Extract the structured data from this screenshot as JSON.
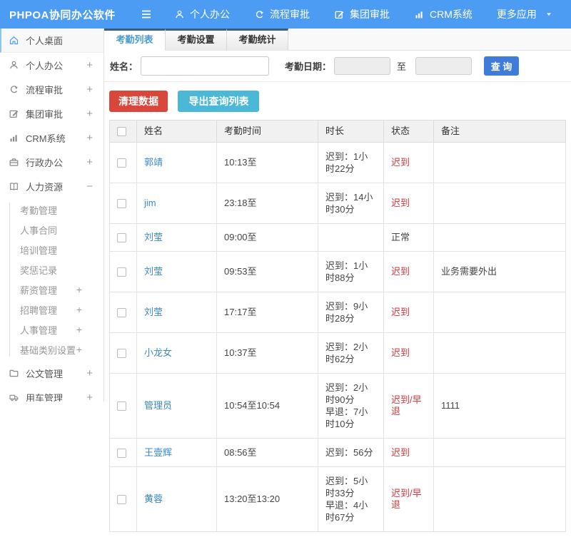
{
  "app": {
    "title": "PHPOA协同办公软件"
  },
  "header": {
    "nav": [
      {
        "key": "personal-office",
        "label": "个人办公",
        "icon": "user-icon"
      },
      {
        "key": "workflow-approval",
        "label": "流程审批",
        "icon": "flow-icon"
      },
      {
        "key": "group-approval",
        "label": "集团审批",
        "icon": "edit-icon"
      },
      {
        "key": "crm-system",
        "label": "CRM系统",
        "icon": "bar-chart-icon"
      },
      {
        "key": "more-apps",
        "label": "更多应用",
        "icon": "caret-down-icon",
        "has_caret": true
      }
    ]
  },
  "sidebar": {
    "items": [
      {
        "key": "personal-desktop",
        "label": "个人桌面",
        "icon": "home-icon",
        "active": true,
        "expand": ""
      },
      {
        "key": "personal-office",
        "label": "个人办公",
        "icon": "user-icon",
        "expand": "+"
      },
      {
        "key": "workflow-approval",
        "label": "流程审批",
        "icon": "flow-icon",
        "expand": "+"
      },
      {
        "key": "group-approval",
        "label": "集团审批",
        "icon": "edit-icon",
        "expand": "+"
      },
      {
        "key": "crm-system",
        "label": "CRM系统",
        "icon": "bar-chart-icon",
        "expand": "+"
      },
      {
        "key": "admin-office",
        "label": "行政办公",
        "icon": "briefcase-icon",
        "expand": "+"
      },
      {
        "key": "human-resources",
        "label": "人力资源",
        "icon": "book-icon",
        "expand": "−",
        "children": [
          {
            "key": "attendance-mgmt",
            "label": "考勤管理",
            "expand": ""
          },
          {
            "key": "hr-contract",
            "label": "人事合同",
            "expand": ""
          },
          {
            "key": "training-mgmt",
            "label": "培训管理",
            "expand": ""
          },
          {
            "key": "reward-punish",
            "label": "奖惩记录",
            "expand": ""
          },
          {
            "key": "salary-mgmt",
            "label": "薪资管理",
            "expand": "+"
          },
          {
            "key": "recruit-mgmt",
            "label": "招聘管理",
            "expand": "+"
          },
          {
            "key": "personnel-mgmt",
            "label": "人事管理",
            "expand": "+"
          },
          {
            "key": "base-category",
            "label": "基础类别设置",
            "expand": "+"
          }
        ]
      },
      {
        "key": "document-mgmt",
        "label": "公文管理",
        "icon": "doc-icon",
        "expand": "+"
      },
      {
        "key": "vehicle-mgmt",
        "label": "用车管理",
        "icon": "truck-icon",
        "expand": "+"
      }
    ]
  },
  "tabs": [
    {
      "key": "attendance-list",
      "label": "考勤列表",
      "active": true
    },
    {
      "key": "attendance-setting",
      "label": "考勤设置",
      "active": false
    },
    {
      "key": "attendance-stats",
      "label": "考勤统计",
      "active": false
    }
  ],
  "filter": {
    "name_label": "姓名：",
    "name_value": "",
    "name_placeholder": "",
    "date_label": "考勤日期：",
    "date_from_value": "",
    "to_label": "至",
    "date_to_value": "",
    "query_button": "查 询"
  },
  "toolbar": {
    "clean_button": "清理数据",
    "export_button": "导出查询列表"
  },
  "attendance_table": {
    "columns": [
      "姓名",
      "考勤时间",
      "时长",
      "状态",
      "备注"
    ],
    "rows": [
      {
        "name": "郭靖",
        "time": "10:13至",
        "duration": [
          "迟到：1小时22分"
        ],
        "status": "迟到",
        "abnormal": true,
        "note": ""
      },
      {
        "name": "jim",
        "time": "23:18至",
        "duration": [
          "迟到：14小时30分"
        ],
        "status": "迟到",
        "abnormal": true,
        "note": ""
      },
      {
        "name": "刘莹",
        "time": "09:00至",
        "duration": [],
        "status": "正常",
        "abnormal": false,
        "note": ""
      },
      {
        "name": "刘莹",
        "time": "09:53至",
        "duration": [
          "迟到：1小时88分"
        ],
        "status": "迟到",
        "abnormal": true,
        "note": "业务需要外出"
      },
      {
        "name": "刘莹",
        "time": "17:17至",
        "duration": [
          "迟到：9小时28分"
        ],
        "status": "迟到",
        "abnormal": true,
        "note": ""
      },
      {
        "name": "小龙女",
        "time": "10:37至",
        "duration": [
          "迟到：2小时62分"
        ],
        "status": "迟到",
        "abnormal": true,
        "note": ""
      },
      {
        "name": "管理员",
        "time": "10:54至10:54",
        "duration": [
          "迟到：2小时90分",
          "早退：7小时10分"
        ],
        "status": "迟到/早退",
        "abnormal": true,
        "note": "1111"
      },
      {
        "name": "王壹辉",
        "time": "08:56至",
        "duration": [
          "迟到：56分"
        ],
        "status": "迟到",
        "abnormal": true,
        "note": ""
      },
      {
        "name": "黄蓉",
        "time": "13:20至13:20",
        "duration": [
          "迟到：5小时33分",
          "早退：4小时67分"
        ],
        "status": "迟到/早退",
        "abnormal": true,
        "note": ""
      }
    ]
  },
  "colors": {
    "header_bg": "#4c9cf4",
    "tab_top_strip": "#3b5e80",
    "tab_active_text": "#4a9ad2",
    "query_blue": "#3f7bd9",
    "danger_red": "#d9463c",
    "export_teal": "#4cb8d8",
    "status_red": "#cc3b3e",
    "link_blue": "#3a88c8"
  }
}
